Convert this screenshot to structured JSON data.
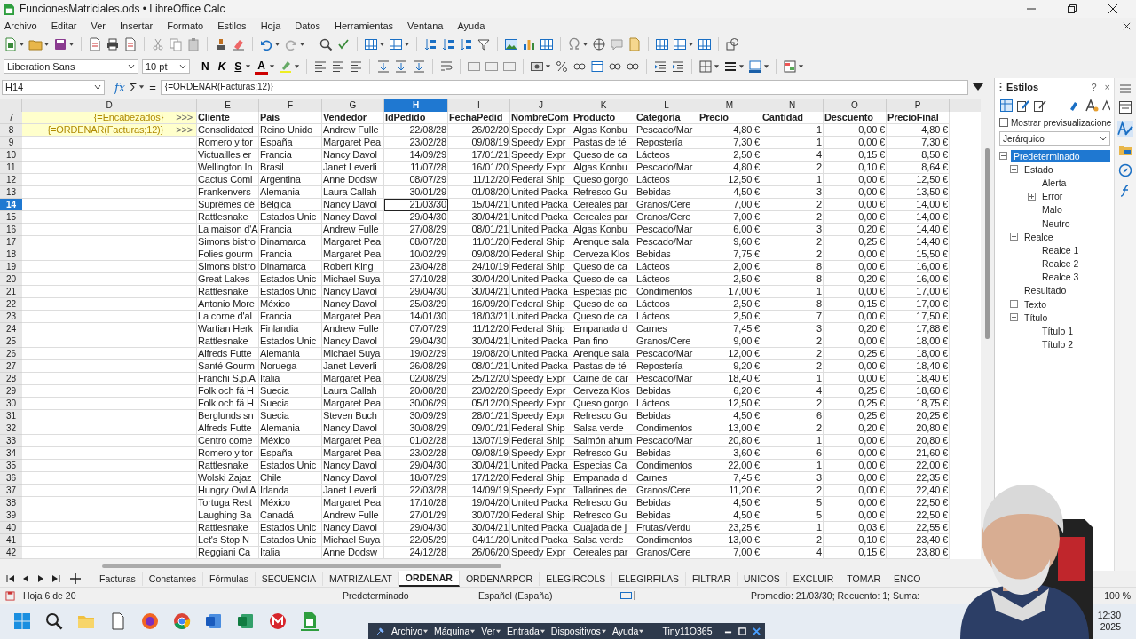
{
  "window": {
    "title": "FuncionesMatriciales.ods • LibreOffice Calc"
  },
  "menu": [
    "Archivo",
    "Editar",
    "Ver",
    "Insertar",
    "Formato",
    "Estilos",
    "Hoja",
    "Datos",
    "Herramientas",
    "Ventana",
    "Ayuda"
  ],
  "formatting": {
    "font": "Liberation Sans",
    "size": "10 pt",
    "style_buttons": [
      "N",
      "K",
      "S"
    ],
    "font_color_letter": "A"
  },
  "formula_bar": {
    "cell": "H14",
    "function_wizard": "fx",
    "sum": "Σ",
    "equals": "=",
    "formula": "{=ORDENAR(Facturas;12)}"
  },
  "columns": [
    {
      "label": "D",
      "selected": false
    },
    {
      "label": "E",
      "selected": false
    },
    {
      "label": "F",
      "selected": false
    },
    {
      "label": "G",
      "selected": false
    },
    {
      "label": "H",
      "selected": true
    },
    {
      "label": "I",
      "selected": false
    },
    {
      "label": "J",
      "selected": false
    },
    {
      "label": "K",
      "selected": false
    },
    {
      "label": "L",
      "selected": false
    },
    {
      "label": "M",
      "selected": false
    },
    {
      "label": "N",
      "selected": false
    },
    {
      "label": "O",
      "selected": false
    },
    {
      "label": "P",
      "selected": false
    }
  ],
  "rows": [
    {
      "number": "7",
      "selected": false,
      "kind": "header",
      "formula": "{=Encabezados}",
      "marker": ">>>",
      "cells": [
        "Cliente",
        "País",
        "Vendedor",
        "IdPedido",
        "FechaPedid",
        "NombreCom",
        "Producto",
        "Categoría",
        "Precio",
        "Cantidad",
        "Descuento",
        "PrecioFinal"
      ]
    },
    {
      "number": "8",
      "selected": false,
      "kind": "data",
      "formula": "{=ORDENAR(Facturas;12)}",
      "marker": ">>>",
      "cells": [
        "Consolidated",
        "Reino Unido",
        "Andrew Fulle",
        "22/08/28",
        "26/02/20",
        "Speedy Expr",
        "Algas Konbu",
        "Pescado/Mar",
        "4,80 €",
        "1",
        "0,00 €",
        "4,80 €"
      ]
    },
    {
      "number": "9",
      "selected": false,
      "kind": "data",
      "cells": [
        "Romero y tor",
        "España",
        "Margaret Pea",
        "23/02/28",
        "09/08/19",
        "Speedy Expr",
        "Pastas de té",
        "Repostería",
        "7,30 €",
        "1",
        "0,00 €",
        "7,30 €"
      ]
    },
    {
      "number": "10",
      "selected": false,
      "kind": "data",
      "cells": [
        "Victuailles er",
        "Francia",
        "Nancy Davol",
        "14/09/29",
        "17/01/21",
        "Speedy Expr",
        "Queso de ca",
        "Lácteos",
        "2,50 €",
        "4",
        "0,15 €",
        "8,50 €"
      ]
    },
    {
      "number": "11",
      "selected": false,
      "kind": "data",
      "cells": [
        "Wellington In",
        "Brasil",
        "Janet Leverli",
        "11/07/28",
        "16/01/20",
        "Speedy Expr",
        "Algas Konbu",
        "Pescado/Mar",
        "4,80 €",
        "2",
        "0,10 €",
        "8,64 €"
      ]
    },
    {
      "number": "12",
      "selected": false,
      "kind": "data",
      "cells": [
        "Cactus Comi",
        "Argentina",
        "Anne Dodsw",
        "08/07/29",
        "11/12/20",
        "Federal Ship",
        "Queso gorgo",
        "Lácteos",
        "12,50 €",
        "1",
        "0,00 €",
        "12,50 €"
      ]
    },
    {
      "number": "13",
      "selected": false,
      "kind": "data",
      "cells": [
        "Frankenvers",
        "Alemania",
        "Laura Callah",
        "30/01/29",
        "01/08/20",
        "United Packa",
        "Refresco Gu",
        "Bebidas",
        "4,50 €",
        "3",
        "0,00 €",
        "13,50 €"
      ]
    },
    {
      "number": "14",
      "selected": true,
      "kind": "data",
      "cells": [
        "Suprêmes dé",
        "Bélgica",
        "Nancy Davol",
        "21/03/30",
        "15/04/21",
        "United Packa",
        "Cereales par",
        "Granos/Cere",
        "7,00 €",
        "2",
        "0,00 €",
        "14,00 €"
      ]
    },
    {
      "number": "15",
      "selected": false,
      "kind": "data",
      "cells": [
        "Rattlesnake",
        "Estados Unic",
        "Nancy Davol",
        "29/04/30",
        "30/04/21",
        "United Packa",
        "Cereales par",
        "Granos/Cere",
        "7,00 €",
        "2",
        "0,00 €",
        "14,00 €"
      ]
    },
    {
      "number": "16",
      "selected": false,
      "kind": "data",
      "cells": [
        "La maison d'A",
        "Francia",
        "Andrew Fulle",
        "27/08/29",
        "08/01/21",
        "United Packa",
        "Algas Konbu",
        "Pescado/Mar",
        "6,00 €",
        "3",
        "0,20 €",
        "14,40 €"
      ]
    },
    {
      "number": "17",
      "selected": false,
      "kind": "data",
      "cells": [
        "Simons bistro",
        "Dinamarca",
        "Margaret Pea",
        "08/07/28",
        "11/01/20",
        "Federal Ship",
        "Arenque sala",
        "Pescado/Mar",
        "9,60 €",
        "2",
        "0,25 €",
        "14,40 €"
      ]
    },
    {
      "number": "18",
      "selected": false,
      "kind": "data",
      "cells": [
        "Folies gourm",
        "Francia",
        "Margaret Pea",
        "10/02/29",
        "09/08/20",
        "Federal Ship",
        "Cerveza Klos",
        "Bebidas",
        "7,75 €",
        "2",
        "0,00 €",
        "15,50 €"
      ]
    },
    {
      "number": "19",
      "selected": false,
      "kind": "data",
      "cells": [
        "Simons bistro",
        "Dinamarca",
        "Robert King",
        "23/04/28",
        "24/10/19",
        "Federal Ship",
        "Queso de ca",
        "Lácteos",
        "2,00 €",
        "8",
        "0,00 €",
        "16,00 €"
      ]
    },
    {
      "number": "20",
      "selected": false,
      "kind": "data",
      "cells": [
        "Great Lakes",
        "Estados Unic",
        "Michael Suya",
        "27/10/28",
        "30/04/20",
        "United Packa",
        "Queso de ca",
        "Lácteos",
        "2,50 €",
        "8",
        "0,20 €",
        "16,00 €"
      ]
    },
    {
      "number": "21",
      "selected": false,
      "kind": "data",
      "cells": [
        "Rattlesnake",
        "Estados Unic",
        "Nancy Davol",
        "29/04/30",
        "30/04/21",
        "United Packa",
        "Especias pic",
        "Condimentos",
        "17,00 €",
        "1",
        "0,00 €",
        "17,00 €"
      ]
    },
    {
      "number": "22",
      "selected": false,
      "kind": "data",
      "cells": [
        "Antonio More",
        "México",
        "Nancy Davol",
        "25/03/29",
        "16/09/20",
        "Federal Ship",
        "Queso de ca",
        "Lácteos",
        "2,50 €",
        "8",
        "0,15 €",
        "17,00 €"
      ]
    },
    {
      "number": "23",
      "selected": false,
      "kind": "data",
      "cells": [
        "La corne d'al",
        "Francia",
        "Margaret Pea",
        "14/01/30",
        "18/03/21",
        "United Packa",
        "Queso de ca",
        "Lácteos",
        "2,50 €",
        "7",
        "0,00 €",
        "17,50 €"
      ]
    },
    {
      "number": "24",
      "selected": false,
      "kind": "data",
      "cells": [
        "Wartian Herk",
        "Finlandia",
        "Andrew Fulle",
        "07/07/29",
        "11/12/20",
        "Federal Ship",
        "Empanada d",
        "Carnes",
        "7,45 €",
        "3",
        "0,20 €",
        "17,88 €"
      ]
    },
    {
      "number": "25",
      "selected": false,
      "kind": "data",
      "cells": [
        "Rattlesnake",
        "Estados Unic",
        "Nancy Davol",
        "29/04/30",
        "30/04/21",
        "United Packa",
        "Pan fino",
        "Granos/Cere",
        "9,00 €",
        "2",
        "0,00 €",
        "18,00 €"
      ]
    },
    {
      "number": "26",
      "selected": false,
      "kind": "data",
      "cells": [
        "Alfreds Futte",
        "Alemania",
        "Michael Suya",
        "19/02/29",
        "19/08/20",
        "United Packa",
        "Arenque sala",
        "Pescado/Mar",
        "12,00 €",
        "2",
        "0,25 €",
        "18,00 €"
      ]
    },
    {
      "number": "27",
      "selected": false,
      "kind": "data",
      "cells": [
        "Santé Gourm",
        "Noruega",
        "Janet Leverli",
        "26/08/29",
        "08/01/21",
        "United Packa",
        "Pastas de té",
        "Repostería",
        "9,20 €",
        "2",
        "0,00 €",
        "18,40 €"
      ]
    },
    {
      "number": "28",
      "selected": false,
      "kind": "data",
      "cells": [
        "Franchi S.p.A",
        "Italia",
        "Margaret Pea",
        "02/08/29",
        "25/12/20",
        "Speedy Expr",
        "Carne de car",
        "Pescado/Mar",
        "18,40 €",
        "1",
        "0,00 €",
        "18,40 €"
      ]
    },
    {
      "number": "29",
      "selected": false,
      "kind": "data",
      "cells": [
        "Folk och fä H",
        "Suecia",
        "Laura Callah",
        "20/08/28",
        "23/02/20",
        "Speedy Expr",
        "Cerveza Klos",
        "Bebidas",
        "6,20 €",
        "4",
        "0,25 €",
        "18,60 €"
      ]
    },
    {
      "number": "30",
      "selected": false,
      "kind": "data",
      "cells": [
        "Folk och fä H",
        "Suecia",
        "Margaret Pea",
        "30/06/29",
        "05/12/20",
        "Speedy Expr",
        "Queso gorgo",
        "Lácteos",
        "12,50 €",
        "2",
        "0,25 €",
        "18,75 €"
      ]
    },
    {
      "number": "31",
      "selected": false,
      "kind": "data",
      "cells": [
        "Berglunds sn",
        "Suecia",
        "Steven Buch",
        "30/09/29",
        "28/01/21",
        "Speedy Expr",
        "Refresco Gu",
        "Bebidas",
        "4,50 €",
        "6",
        "0,25 €",
        "20,25 €"
      ]
    },
    {
      "number": "32",
      "selected": false,
      "kind": "data",
      "cells": [
        "Alfreds Futte",
        "Alemania",
        "Nancy Davol",
        "30/08/29",
        "09/01/21",
        "Federal Ship",
        "Salsa verde",
        "Condimentos",
        "13,00 €",
        "2",
        "0,20 €",
        "20,80 €"
      ]
    },
    {
      "number": "33",
      "selected": false,
      "kind": "data",
      "cells": [
        "Centro come",
        "México",
        "Margaret Pea",
        "01/02/28",
        "13/07/19",
        "Federal Ship",
        "Salmón ahum",
        "Pescado/Mar",
        "20,80 €",
        "1",
        "0,00 €",
        "20,80 €"
      ]
    },
    {
      "number": "34",
      "selected": false,
      "kind": "data",
      "cells": [
        "Romero y tor",
        "España",
        "Margaret Pea",
        "23/02/28",
        "09/08/19",
        "Speedy Expr",
        "Refresco Gu",
        "Bebidas",
        "3,60 €",
        "6",
        "0,00 €",
        "21,60 €"
      ]
    },
    {
      "number": "35",
      "selected": false,
      "kind": "data",
      "cells": [
        "Rattlesnake",
        "Estados Unic",
        "Nancy Davol",
        "29/04/30",
        "30/04/21",
        "United Packa",
        "Especias Ca",
        "Condimentos",
        "22,00 €",
        "1",
        "0,00 €",
        "22,00 €"
      ]
    },
    {
      "number": "36",
      "selected": false,
      "kind": "data",
      "cells": [
        "Wolski  Zajaz",
        "Chile",
        "Nancy Davol",
        "18/07/29",
        "17/12/20",
        "Federal Ship",
        "Empanada d",
        "Carnes",
        "7,45 €",
        "3",
        "0,00 €",
        "22,35 €"
      ]
    },
    {
      "number": "37",
      "selected": false,
      "kind": "data",
      "cells": [
        "Hungry Owl A",
        "Irlanda",
        "Janet Leverli",
        "22/03/28",
        "14/09/19",
        "Speedy Expr",
        "Tallarines de",
        "Granos/Cere",
        "11,20 €",
        "2",
        "0,00 €",
        "22,40 €"
      ]
    },
    {
      "number": "38",
      "selected": false,
      "kind": "data",
      "cells": [
        "Tortuga Rest",
        "México",
        "Margaret Pea",
        "17/10/28",
        "19/04/20",
        "United Packa",
        "Refresco Gu",
        "Bebidas",
        "4,50 €",
        "5",
        "0,00 €",
        "22,50 €"
      ]
    },
    {
      "number": "39",
      "selected": false,
      "kind": "data",
      "cells": [
        "Laughing Ba",
        "Canadá",
        "Andrew Fulle",
        "27/01/29",
        "30/07/20",
        "Federal Ship",
        "Refresco Gu",
        "Bebidas",
        "4,50 €",
        "5",
        "0,00 €",
        "22,50 €"
      ]
    },
    {
      "number": "40",
      "selected": false,
      "kind": "data",
      "cells": [
        "Rattlesnake",
        "Estados Unic",
        "Nancy Davol",
        "29/04/30",
        "30/04/21",
        "United Packa",
        "Cuajada de j",
        "Frutas/Verdu",
        "23,25 €",
        "1",
        "0,03 €",
        "22,55 €"
      ]
    },
    {
      "number": "41",
      "selected": false,
      "kind": "data",
      "cells": [
        "Let's Stop N",
        "Estados Unic",
        "Michael Suya",
        "22/05/29",
        "04/11/20",
        "United Packa",
        "Salsa verde",
        "Condimentos",
        "13,00 €",
        "2",
        "0,10 €",
        "23,40 €"
      ]
    },
    {
      "number": "42",
      "selected": false,
      "kind": "data",
      "cells": [
        "Reggiani Ca",
        "Italia",
        "Anne Dodsw",
        "24/12/28",
        "26/06/20",
        "Speedy Expr",
        "Cereales par",
        "Granos/Cere",
        "7,00 €",
        "4",
        "0,15 €",
        "23,80 €"
      ]
    }
  ],
  "sheet_tabs": [
    {
      "label": "Facturas",
      "selected": false
    },
    {
      "label": "Constantes",
      "selected": false
    },
    {
      "label": "Fórmulas",
      "selected": false
    },
    {
      "label": "SECUENCIA",
      "selected": false
    },
    {
      "label": "MATRIZALEAT",
      "selected": false
    },
    {
      "label": "ORDENAR",
      "selected": true
    },
    {
      "label": "ORDENARPOR",
      "selected": false
    },
    {
      "label": "ELEGIRCOLS",
      "selected": false
    },
    {
      "label": "ELEGIRFILAS",
      "selected": false
    },
    {
      "label": "FILTRAR",
      "selected": false
    },
    {
      "label": "UNICOS",
      "selected": false
    },
    {
      "label": "EXCLUIR",
      "selected": false
    },
    {
      "label": "TOMAR",
      "selected": false
    },
    {
      "label": "ENCO",
      "selected": false
    }
  ],
  "status_bar": {
    "sheet": "Hoja 6 de 20",
    "page_style": "Predeterminado",
    "language": "Español (España)",
    "summary": "Promedio: 21/03/30; Recuento: 1; Suma:",
    "zoom": "100 %"
  },
  "sidebar": {
    "title": "Estilos",
    "help": "?",
    "close": "×",
    "preview_checkbox": {
      "label": "Mostrar previsualizacione",
      "checked": false
    },
    "view_mode": "Jerárquico",
    "tree": [
      {
        "label": "Predeterminado",
        "selected": true,
        "expanded": true,
        "children": [
          {
            "label": "Estado",
            "selected": false,
            "expanded": true,
            "children": [
              {
                "label": "Alerta",
                "selected": false
              },
              {
                "label": "Error",
                "selected": false,
                "expanded": false
              },
              {
                "label": "Malo",
                "selected": false
              },
              {
                "label": "Neutro",
                "selected": false
              }
            ]
          },
          {
            "label": "Realce",
            "selected": false,
            "expanded": true,
            "children": [
              {
                "label": "Realce 1",
                "selected": false
              },
              {
                "label": "Realce 2",
                "selected": false
              },
              {
                "label": "Realce 3",
                "selected": false
              }
            ]
          },
          {
            "label": "Resultado",
            "selected": false
          },
          {
            "label": "Texto",
            "selected": false,
            "expanded": false
          },
          {
            "label": "Título",
            "selected": false,
            "expanded": true,
            "children": [
              {
                "label": "Título 1",
                "selected": false
              },
              {
                "label": "Título 2",
                "selected": false
              }
            ]
          }
        ]
      }
    ]
  },
  "taskbar": {
    "vm_menu": [
      "Archivo",
      "Máquina",
      "Ver",
      "Entrada",
      "Dispositivos",
      "Ayuda"
    ],
    "vm_name": "Tiny11O365",
    "time": "12:30",
    "date": "2025"
  },
  "webcam": {
    "kind": "picture"
  }
}
